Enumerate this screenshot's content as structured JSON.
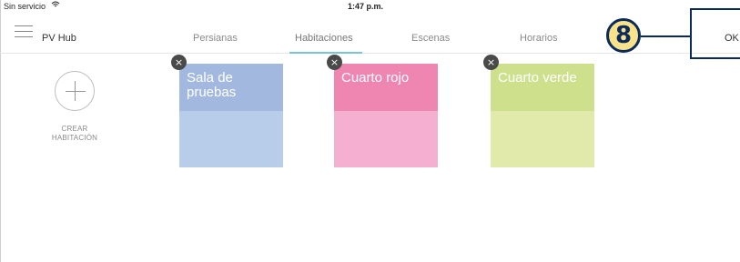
{
  "status_bar": {
    "carrier": "Sin servicio",
    "wifi_icon": "wifi-icon",
    "time": "1:47 p.m."
  },
  "nav": {
    "app_title": "PV Hub",
    "menu_icon": "hamburger-menu-icon",
    "tabs": [
      {
        "label": "Persianas"
      },
      {
        "label": "Habitaciones",
        "active": true
      },
      {
        "label": "Escenas"
      },
      {
        "label": "Horarios"
      }
    ],
    "ok_label": "OK",
    "accent_color": "#7bc4d8"
  },
  "callout": {
    "number": "8",
    "badge_color": "#f9e28a",
    "border_color": "#0b2a5c"
  },
  "create_room": {
    "label_line1": "CREAR",
    "label_line2": "HABITACIÓN",
    "icon": "plus-circle-icon"
  },
  "rooms": [
    {
      "name_line1": "Sala de",
      "name_line2": "pruebas",
      "top_color": "#a2b8df",
      "bottom_color": "#b7cdea"
    },
    {
      "name_line1": "Cuarto rojo",
      "name_line2": "",
      "top_color": "#ef86b2",
      "bottom_color": "#f5b0d1"
    },
    {
      "name_line1": "Cuarto verde",
      "name_line2": "",
      "top_color": "#cfe08c",
      "bottom_color": "#e1eaab"
    }
  ],
  "delete_icon": "close-icon",
  "delete_glyph": "×"
}
